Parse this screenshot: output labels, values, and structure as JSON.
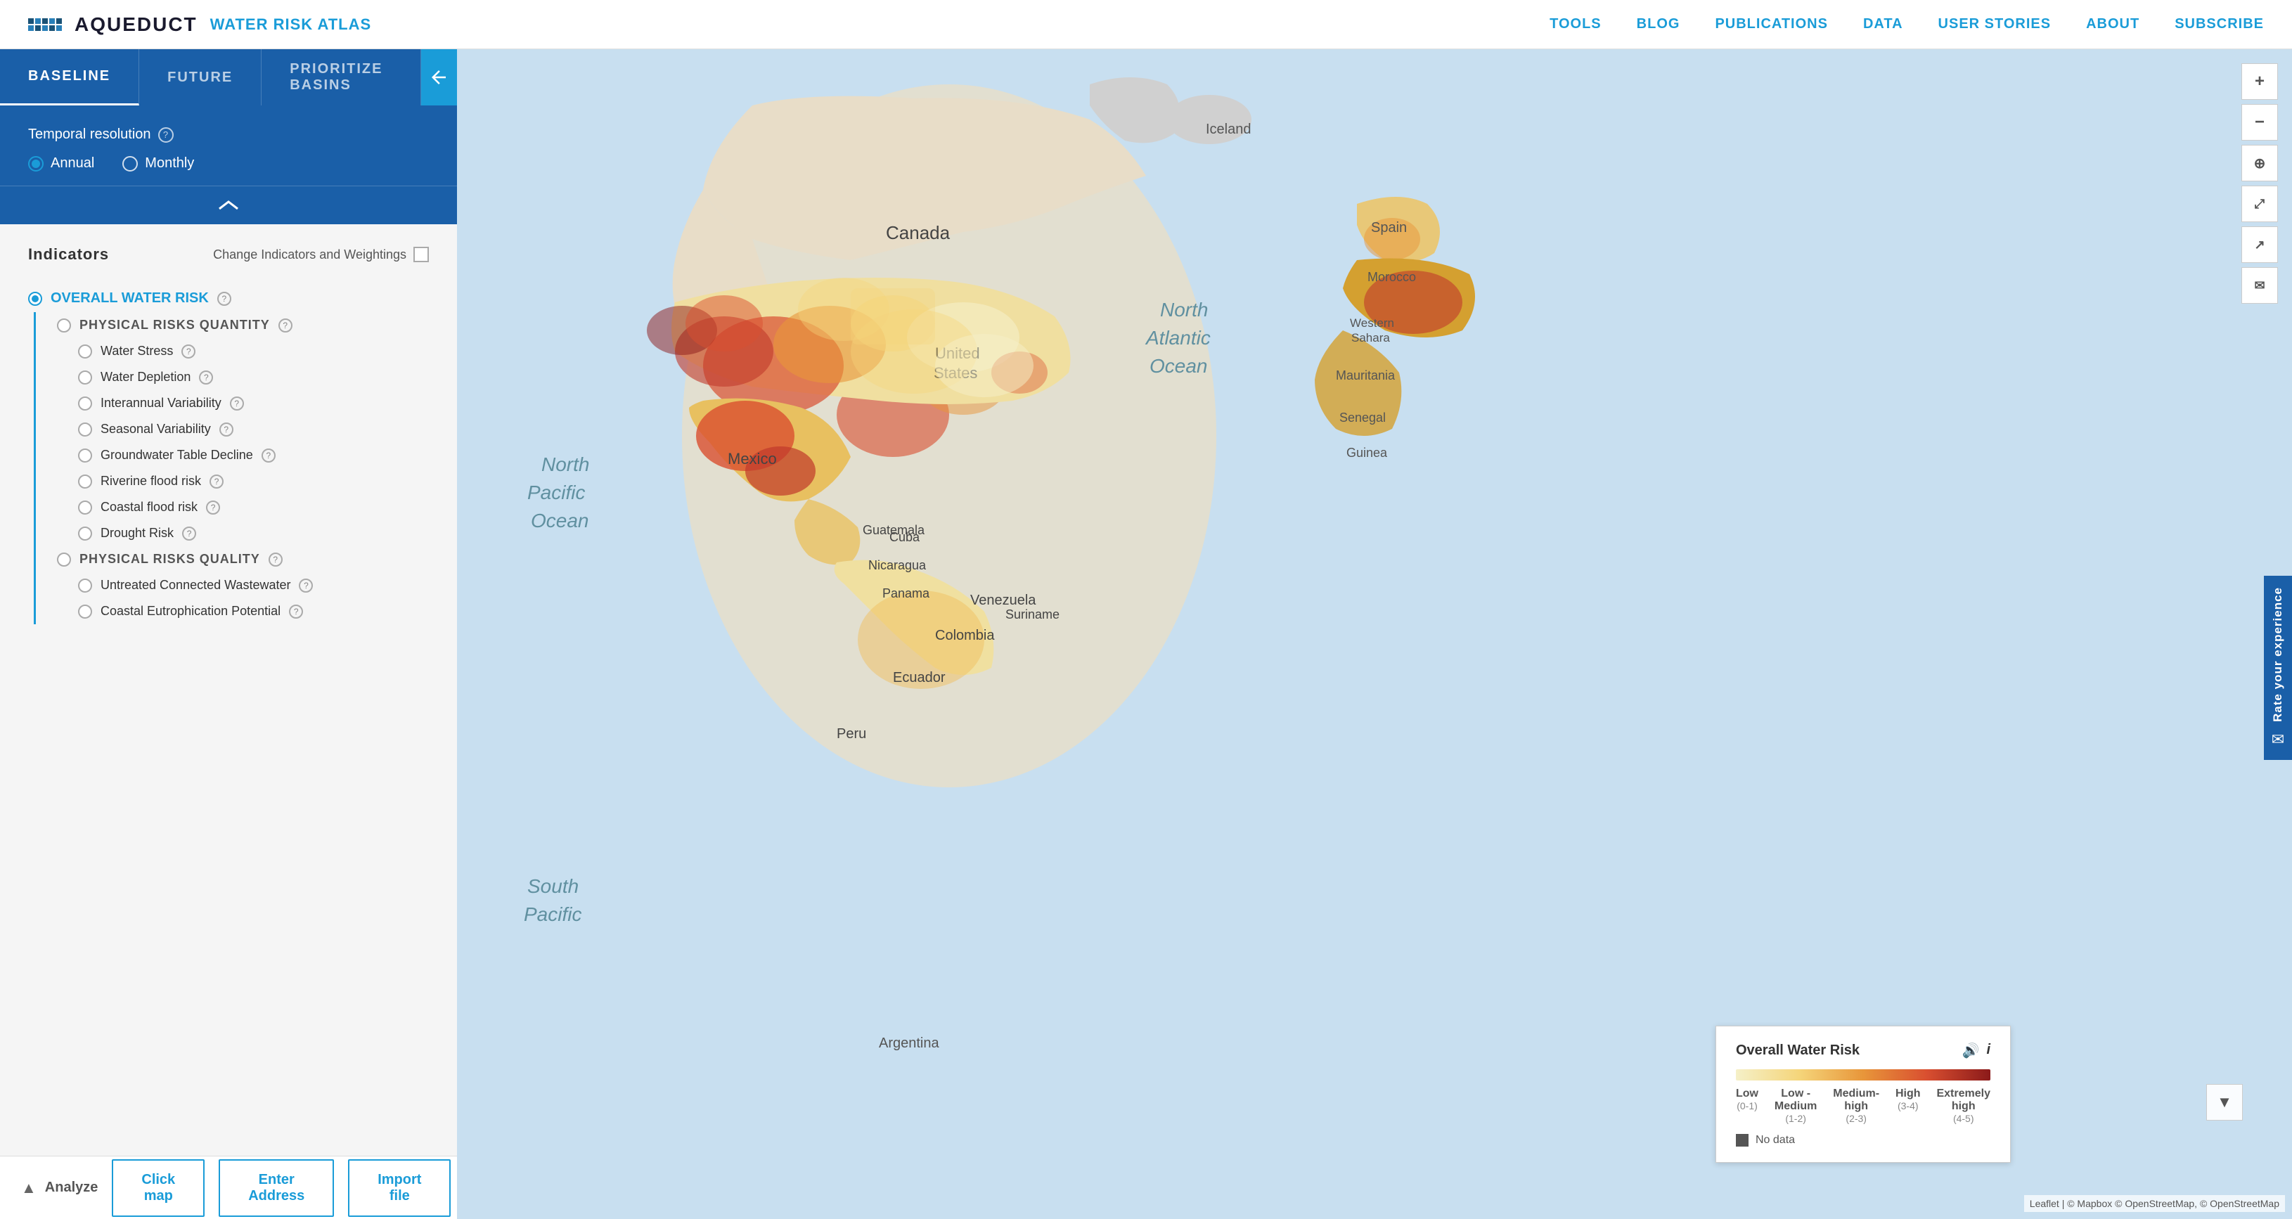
{
  "nav": {
    "logo_name": "AQUEDUCT",
    "logo_subtitle": "WATER RISK ATLAS",
    "links": [
      {
        "label": "TOOLS"
      },
      {
        "label": "BLOG"
      },
      {
        "label": "PUBLICATIONS"
      },
      {
        "label": "DATA"
      },
      {
        "label": "USER STORIES"
      },
      {
        "label": "ABOUT"
      },
      {
        "label": "SUBSCRIBE"
      }
    ]
  },
  "tabs": [
    {
      "label": "BASELINE",
      "active": true
    },
    {
      "label": "FUTURE",
      "active": false
    },
    {
      "label": "PRIORITIZE BASINS",
      "active": false
    }
  ],
  "temporal": {
    "label": "Temporal resolution",
    "options": [
      {
        "label": "Annual",
        "selected": true
      },
      {
        "label": "Monthly",
        "selected": false
      }
    ]
  },
  "indicators": {
    "title": "Indicators",
    "change_label": "Change Indicators and Weightings",
    "items": [
      {
        "label": "OVERALL WATER RISK",
        "selected": true,
        "children": [
          {
            "label": "PHYSICAL RISKS QUANTITY",
            "selected": false,
            "children": [
              {
                "label": "Water Stress",
                "selected": false
              },
              {
                "label": "Water Depletion",
                "selected": false
              },
              {
                "label": "Interannual Variability",
                "selected": false
              },
              {
                "label": "Seasonal Variability",
                "selected": false
              },
              {
                "label": "Groundwater Table Decline",
                "selected": false
              },
              {
                "label": "Riverine flood risk",
                "selected": false
              },
              {
                "label": "Coastal flood risk",
                "selected": false
              },
              {
                "label": "Drought Risk",
                "selected": false
              }
            ]
          },
          {
            "label": "PHYSICAL RISKS QUALITY",
            "selected": false,
            "children": [
              {
                "label": "Untreated Connected Wastewater",
                "selected": false
              },
              {
                "label": "Coastal Eutrophication Potential",
                "selected": false
              }
            ]
          }
        ]
      }
    ]
  },
  "analyze": {
    "label": "Analyze",
    "click_map": "Click map",
    "enter_address": "Enter Address",
    "import_file": "Import file"
  },
  "legend": {
    "title": "Overall Water Risk",
    "labels": [
      {
        "main": "Low",
        "sub": "(0-1)"
      },
      {
        "main": "Low -\nMedium",
        "sub": "(1-2)"
      },
      {
        "main": "Medium-\nhigh",
        "sub": "(2-3)"
      },
      {
        "main": "High",
        "sub": "(3-4)"
      },
      {
        "main": "Extremely\nhigh",
        "sub": "(4-5)"
      }
    ],
    "no_data": "No data"
  },
  "map_labels": [
    {
      "text": "Canada",
      "top": "25%",
      "left": "28%"
    },
    {
      "text": "United\nStates",
      "top": "33%",
      "left": "33%"
    },
    {
      "text": "Mexico",
      "top": "50%",
      "left": "25%"
    },
    {
      "text": "North\nPacific\nOcean",
      "top": "36%",
      "left": "8%"
    },
    {
      "text": "North\nAtlantic\nOcean",
      "top": "28%",
      "left": "68%"
    },
    {
      "text": "Cuba",
      "top": "53%",
      "left": "40%"
    },
    {
      "text": "Guatemala",
      "top": "58%",
      "left": "33%"
    },
    {
      "text": "Nicaragua",
      "top": "62%",
      "left": "37%"
    },
    {
      "text": "Panama",
      "top": "63%",
      "left": "40%"
    },
    {
      "text": "Venezuela",
      "top": "65%",
      "left": "52%"
    },
    {
      "text": "Colombia",
      "top": "68%",
      "left": "44%"
    },
    {
      "text": "Suriname",
      "top": "66%",
      "left": "58%"
    },
    {
      "text": "Ecuador",
      "top": "73%",
      "left": "40%"
    },
    {
      "text": "Peru",
      "top": "78%",
      "left": "36%"
    },
    {
      "text": "South\nPacific",
      "top": "85%",
      "left": "10%"
    },
    {
      "text": "Iceland",
      "top": "7%",
      "left": "70%"
    },
    {
      "text": "Spain",
      "top": "28%",
      "left": "83%"
    },
    {
      "text": "Morocco",
      "top": "35%",
      "left": "83%"
    },
    {
      "text": "Western\nSahara",
      "top": "42%",
      "left": "82%"
    },
    {
      "text": "Mauritania",
      "top": "48%",
      "left": "82%"
    },
    {
      "text": "Senegal",
      "top": "54%",
      "left": "82%"
    },
    {
      "text": "Guinea",
      "top": "60%",
      "left": "82%"
    }
  ],
  "rate_exp": "Rate your experience",
  "attribution": "Leaflet | © Mapbox © OpenStreetMap, © OpenStreetMap"
}
